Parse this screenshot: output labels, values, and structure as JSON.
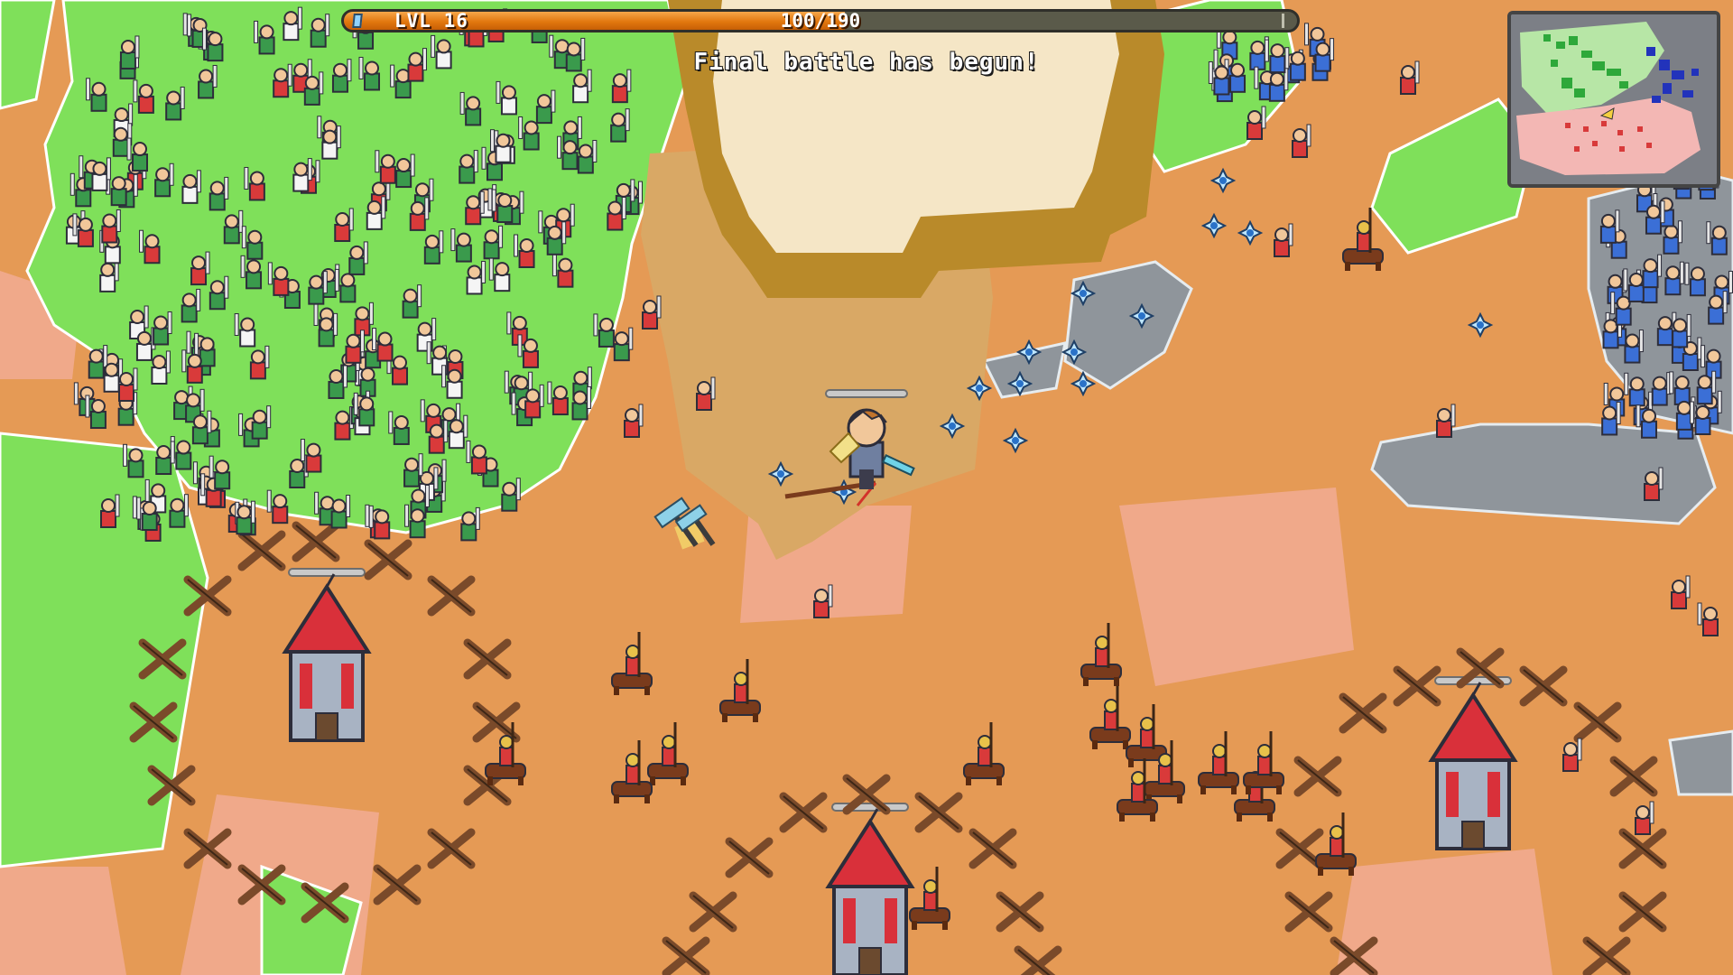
{
  "hud": {
    "level_label": "LVL 16",
    "xp_text": "100/190",
    "xp_fraction": 0.526,
    "colors": {
      "xp_fill": "#e2780f",
      "xp_track": "#5a5a4a"
    }
  },
  "banner": {
    "text": "Final battle has begun!"
  },
  "minimap": {
    "colors": {
      "green_faction": "#2ea83a",
      "blue_faction": "#2233bb",
      "red_faction": "#d83a3a",
      "land": "#b7e6a6",
      "desert": "#f3b7b4",
      "rock": "#7c7f86"
    }
  },
  "world": {
    "colors": {
      "grass": "#7fe05a",
      "sand": "#e59a55",
      "pink_sand": "#f0a98a",
      "rock": "#8f959b",
      "plateau": "#f5e6c6",
      "cliff": "#b98a2a"
    },
    "icons": {
      "player": "player-hero-icon",
      "tower": "red-tower-icon",
      "barricade": "crossed-stake-barricade-icon",
      "soldier": "soldier-icon",
      "cavalry": "cavalry-rider-icon",
      "crystal": "blue-crystal-icon",
      "hammer": "war-hammer-pickup-icon"
    }
  }
}
